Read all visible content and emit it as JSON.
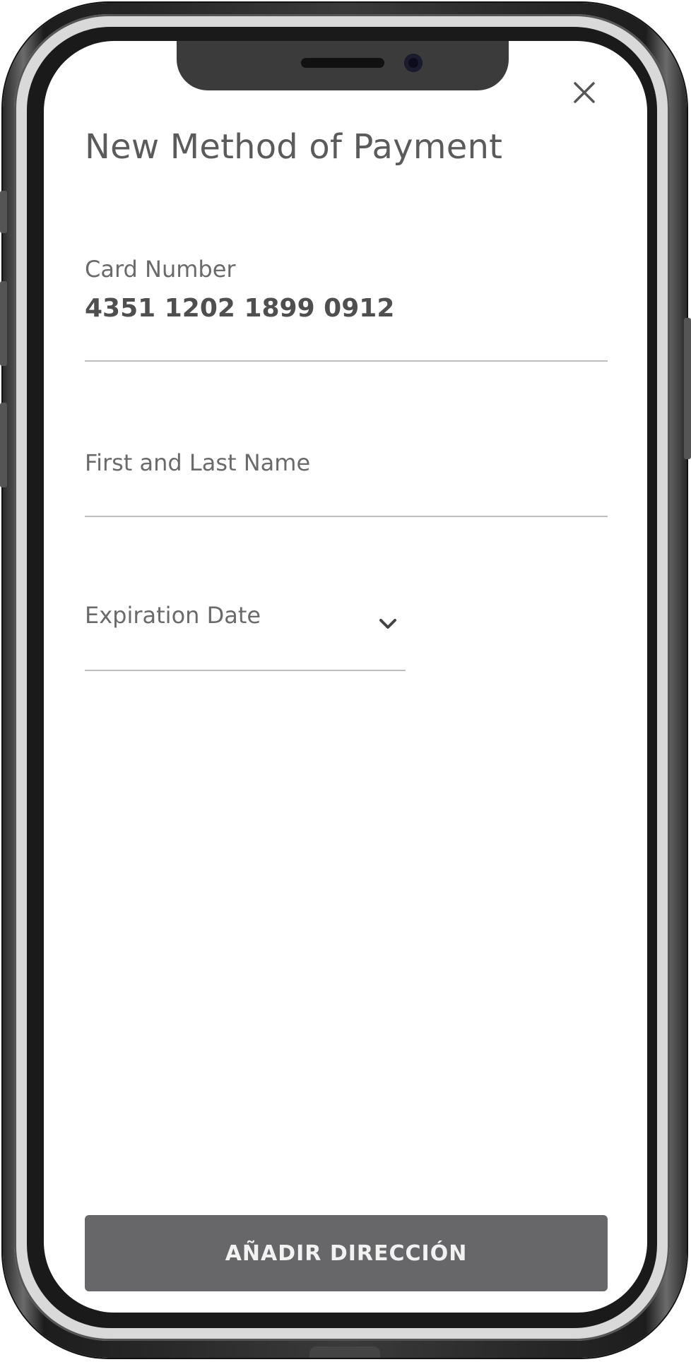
{
  "screen": {
    "title": "New Method of Payment",
    "close_icon": "close-icon"
  },
  "form": {
    "card_number": {
      "label": "Card Number",
      "value": "4351 1202 1899 0912"
    },
    "full_name": {
      "label": "First and Last Name",
      "value": ""
    },
    "expiration_date": {
      "label": "Expiration Date",
      "icon": "chevron-down-icon"
    }
  },
  "actions": {
    "submit_label": "AÑADIR DIRECCIÓN"
  },
  "colors": {
    "button_bg": "#67676a",
    "title_text": "#5b5b5b",
    "divider": "#bdbdbd"
  }
}
